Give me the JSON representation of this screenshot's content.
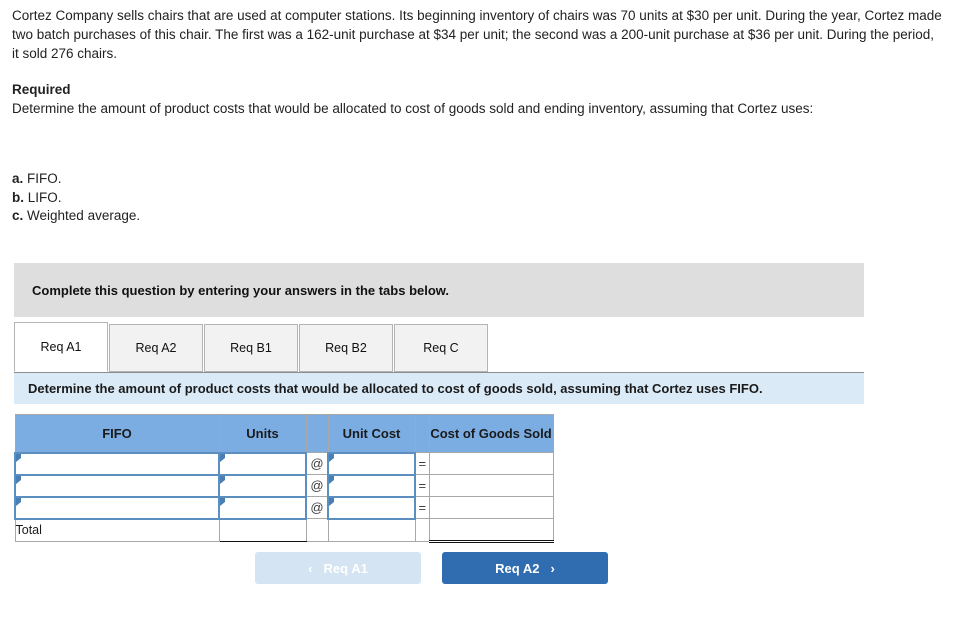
{
  "problem": {
    "statement": "Cortez Company sells chairs that are used at computer stations. Its beginning inventory of chairs was 70 units at $30 per unit. During the year, Cortez made two batch purchases of this chair. The first was a 162-unit purchase at $34 per unit; the second was a 200-unit purchase at $36 per unit. During the period, it sold 276 chairs."
  },
  "required": {
    "title": "Required",
    "text": "Determine the amount of product costs that would be allocated to cost of goods sold and ending inventory, assuming that Cortez uses:",
    "items": [
      {
        "marker": "a.",
        "label": "FIFO."
      },
      {
        "marker": "b.",
        "label": "LIFO."
      },
      {
        "marker": "c.",
        "label": "Weighted average."
      }
    ]
  },
  "instruction_bar": {
    "text": "Complete this question by entering your answers in the tabs below."
  },
  "tabs": [
    {
      "label": "Req A1",
      "active": true
    },
    {
      "label": "Req A2",
      "active": false
    },
    {
      "label": "Req B1",
      "active": false
    },
    {
      "label": "Req B2",
      "active": false
    },
    {
      "label": "Req C",
      "active": false
    }
  ],
  "info_bar": {
    "text": "Determine the amount of product costs that would be allocated to cost of goods sold, assuming that Cortez uses FIFO."
  },
  "table": {
    "headers": [
      "FIFO",
      "Units",
      "",
      "Unit Cost",
      "",
      "Cost of Goods Sold"
    ],
    "rows": [
      {
        "label": "",
        "units": "",
        "op1": "@",
        "unit_cost": "",
        "op2": "=",
        "cogs": ""
      },
      {
        "label": "",
        "units": "",
        "op1": "@",
        "unit_cost": "",
        "op2": "=",
        "cogs": ""
      },
      {
        "label": "",
        "units": "",
        "op1": "@",
        "unit_cost": "",
        "op2": "=",
        "cogs": ""
      }
    ],
    "total_row": {
      "label": "Total",
      "units": "",
      "op1": "",
      "unit_cost": "",
      "op2": "",
      "cogs": ""
    }
  },
  "nav": {
    "prev_label": "Req A1",
    "next_label": "Req A2",
    "prev_chevron": "‹",
    "next_chevron": "›"
  },
  "colors": {
    "header_blue": "#7bade2",
    "info_blue": "#daeaf7",
    "instruction_gray": "#dedede",
    "next_button": "#2f6cb0",
    "prev_button": "#d5e4f2",
    "input_border": "#5b8fc0"
  }
}
